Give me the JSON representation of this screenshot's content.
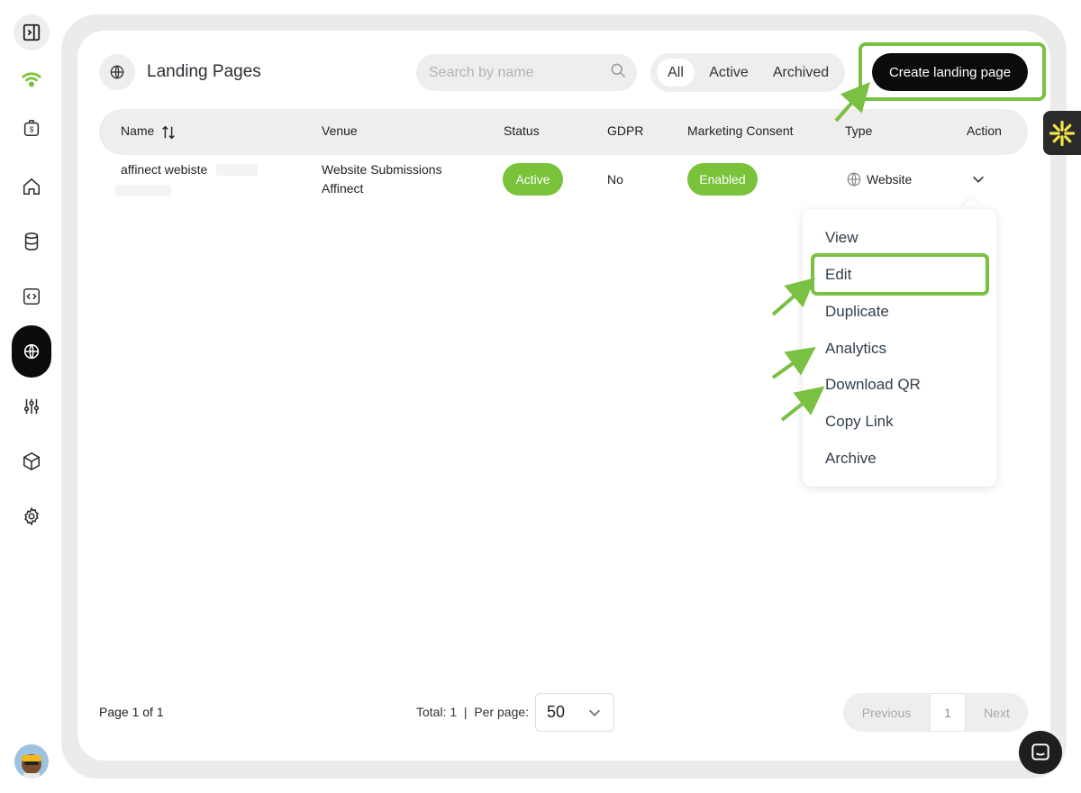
{
  "header": {
    "title": "Landing Pages",
    "search_placeholder": "Search by name",
    "filters": [
      "All",
      "Active",
      "Archived"
    ],
    "create_label": "Create landing page"
  },
  "table": {
    "columns": [
      "Name",
      "Venue",
      "Status",
      "GDPR",
      "Marketing Consent",
      "Type",
      "Action"
    ],
    "rows": [
      {
        "name": "affinect webiste",
        "venue_line1": "Website Submissions",
        "venue_line2": "Affinect",
        "status": "Active",
        "gdpr": "No",
        "marketing_consent": "Enabled",
        "type": "Website"
      }
    ]
  },
  "action_menu": {
    "items": [
      "View",
      "Edit",
      "Duplicate",
      "Analytics",
      "Download QR",
      "Copy Link",
      "Archive"
    ]
  },
  "footer": {
    "page_info": "Page 1 of 1",
    "total": "Total: 1  |  Per page:",
    "per_page": "50",
    "prev": "Previous",
    "page": "1",
    "next": "Next"
  },
  "colors": {
    "accent_green": "#79c23a",
    "highlight_green": "#79c043",
    "dark": "#0b0b0b"
  },
  "icons": {
    "sidebar": [
      "panel-toggle-icon",
      "wifi-logo-icon",
      "money-bag-icon",
      "home-icon",
      "database-icon",
      "code-icon",
      "globe-icon",
      "sliders-icon",
      "cube-icon",
      "gear-icon"
    ]
  }
}
